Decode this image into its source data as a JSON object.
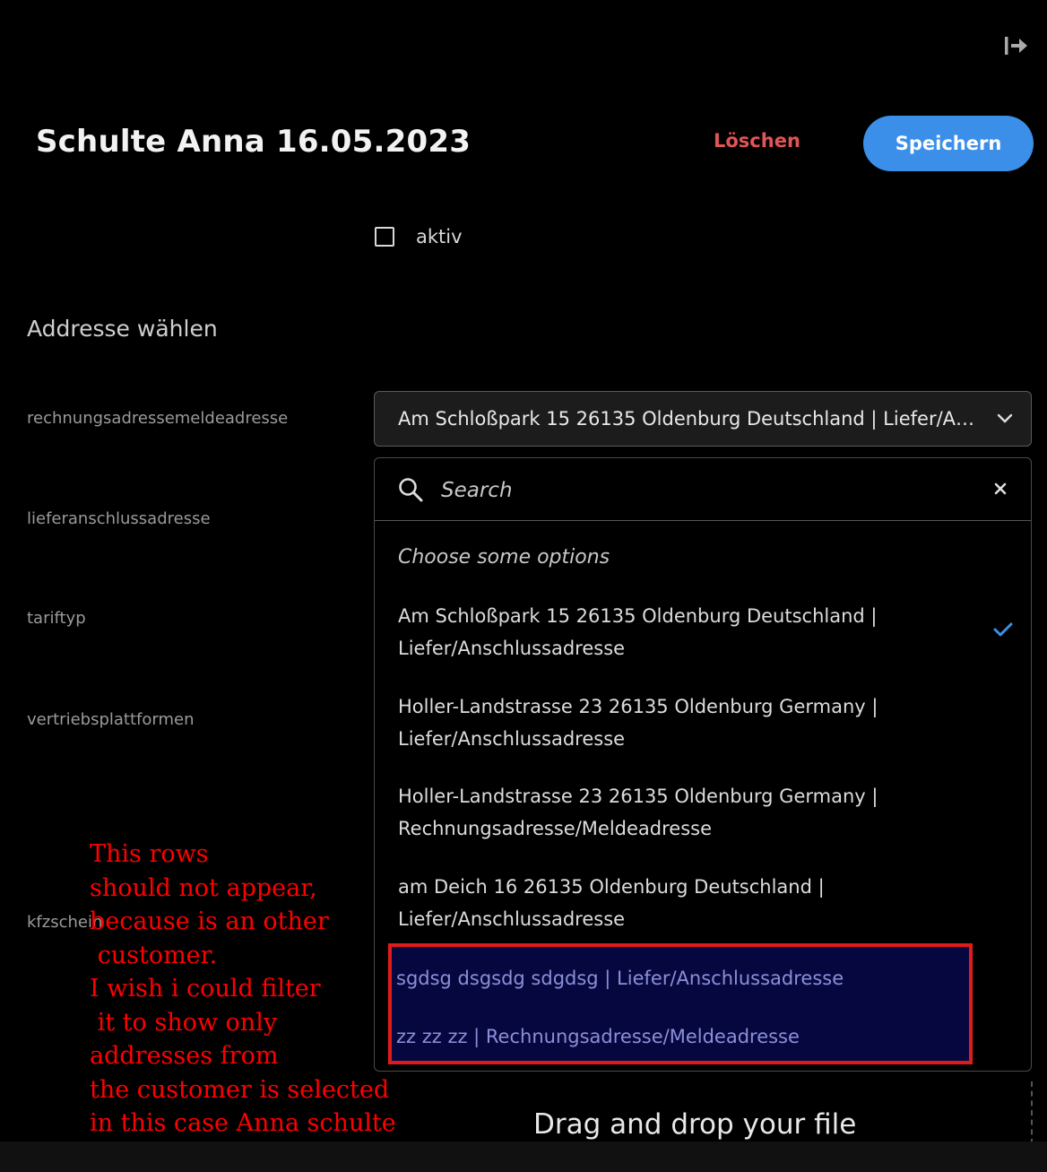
{
  "header": {
    "title": "Schulte Anna 16.05.2023",
    "delete_label": "Löschen",
    "save_label": "Speichern",
    "exit_icon": "logout-arrow-icon"
  },
  "active_checkbox": {
    "label": "aktiv",
    "checked": false
  },
  "section_title": "Addresse wählen",
  "fields": {
    "rechnung": "rechnungsadressemeldeadresse",
    "liefer": "lieferanschlussadresse",
    "tarif": "tariftyp",
    "vertrieb": "vertriebsplattformen",
    "kfz": "kfzschein"
  },
  "select": {
    "value": "Am Schloßpark 15 26135 Oldenburg Deutschland | Liefer/Anschlussadresse"
  },
  "dropdown": {
    "search_placeholder": "Search",
    "hint": "Choose some options",
    "options": [
      {
        "line1": "Am Schloßpark 15 26135 Oldenburg Deutschland |",
        "line2": "Liefer/Anschlussadresse",
        "selected": true
      },
      {
        "line1": "Holler-Landstrasse 23 26135 Oldenburg Germany |",
        "line2": "Liefer/Anschlussadresse",
        "selected": false
      },
      {
        "line1": "Holler-Landstrasse 23 26135 Oldenburg Germany |",
        "line2": "Rechnungsadresse/Meldeadresse",
        "selected": false
      },
      {
        "line1": "am Deich 16 26135 Oldenburg Deutschland |",
        "line2": "Liefer/Anschlussadresse",
        "selected": false
      }
    ],
    "highlighted_options": [
      "sgdsg dsgsdg sdgdsg | Liefer/Anschlussadresse",
      "zz zz zz | Rechnungsadresse/Meldeadresse"
    ]
  },
  "annotation": {
    "text": "This rows\nshould not appear,\nbecause is an other\n customer.\nI wish i could filter\n it to show only\naddresses from\nthe customer is selected\nin this case Anna schulte",
    "color": "#ff0000",
    "box_color": "#e01b1b"
  },
  "dropzone": {
    "text": "Drag and drop your file"
  },
  "colors": {
    "accent": "#3b8fe8",
    "danger": "#e05555"
  }
}
